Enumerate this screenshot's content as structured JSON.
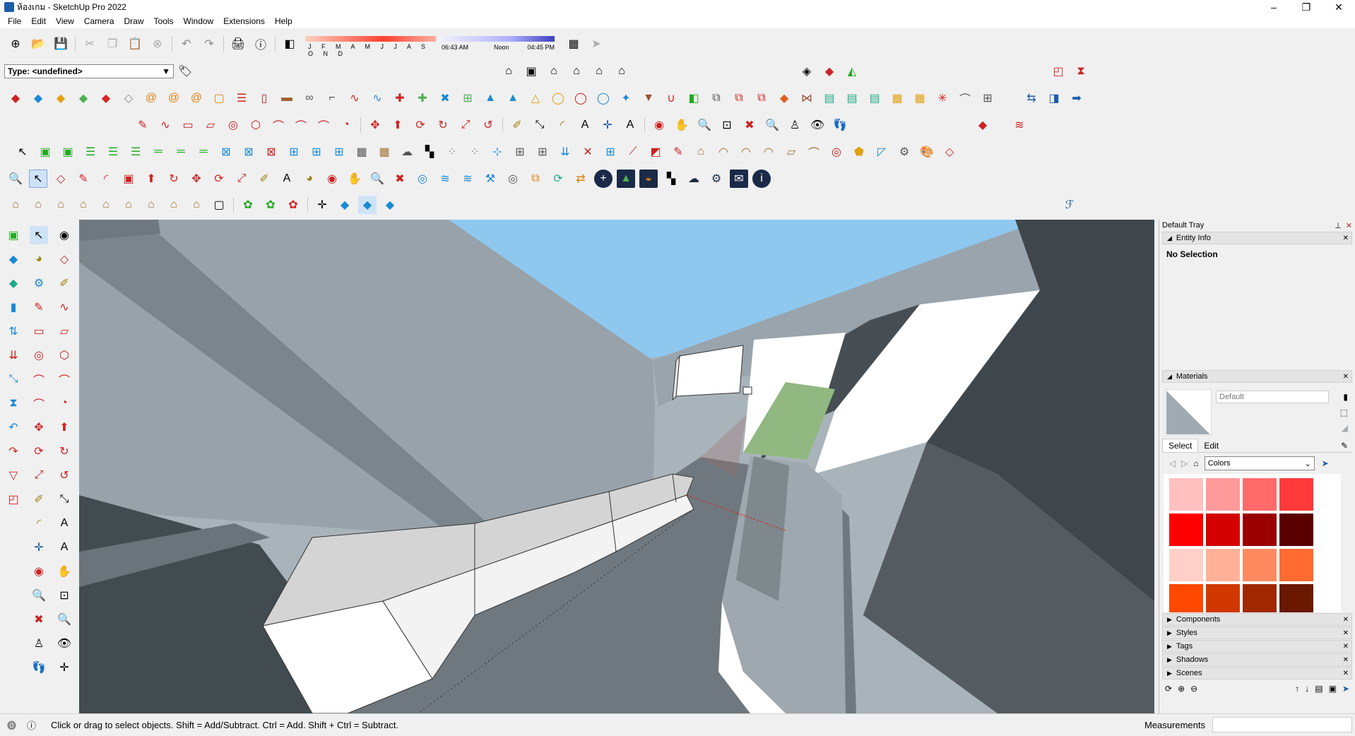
{
  "window": {
    "title": "ห้องเกม - SketchUp Pro 2022",
    "controls": {
      "minimize": "–",
      "maximize": "❐",
      "close": "✕"
    }
  },
  "menu": [
    "File",
    "Edit",
    "View",
    "Camera",
    "Draw",
    "Tools",
    "Window",
    "Extensions",
    "Help"
  ],
  "shadows": {
    "months": "J F M A M J J A S O N D",
    "time_start": "06:43 AM",
    "time_mid": "Noon",
    "time_end": "04:45 PM"
  },
  "type_box": {
    "value": "Type: <undefined>",
    "arrow": "▼"
  },
  "status": {
    "message": "Click or drag to select objects. Shift = Add/Subtract. Ctrl = Add. Shift + Ctrl = Subtract.",
    "measurements_label": "Measurements"
  },
  "tray": {
    "title": "Default Tray",
    "entity_info": {
      "label": "Entity Info",
      "selection": "No Selection"
    },
    "materials": {
      "label": "Materials",
      "name_placeholder": "Default",
      "tab_select": "Select",
      "tab_edit": "Edit",
      "library": "Colors"
    },
    "panels": [
      "Components",
      "Styles",
      "Tags",
      "Shadows",
      "Scenes"
    ],
    "colors": [
      "#ffc0c0",
      "#ff9a9a",
      "#ff6a6a",
      "#ff3a3a",
      "#ff0000",
      "#d40000",
      "#9a0000",
      "#5a0000",
      "#ffd0c8",
      "#ffb098",
      "#ff8a60",
      "#ff6a30",
      "#ff4800",
      "#d03800",
      "#a02800",
      "#6a1800"
    ]
  },
  "icons": {
    "app": "sketchup-logo-icon",
    "select": "select-arrow-icon",
    "orbit": "orbit-icon",
    "paint": "paint-bucket-icon",
    "eraser": "eraser-icon"
  }
}
